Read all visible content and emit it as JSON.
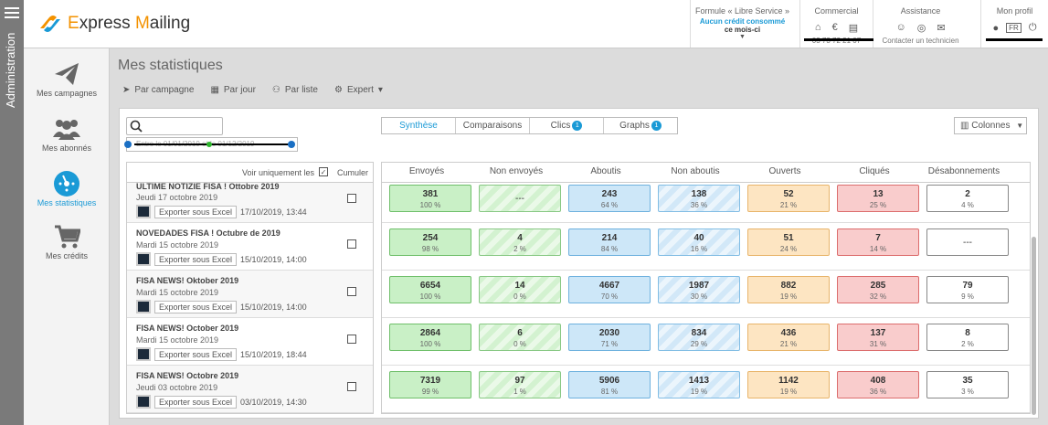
{
  "admin": {
    "label": "Administration"
  },
  "logo": {
    "part1": "E",
    "part2": "xpress ",
    "part3": "M",
    "part4": "ailing"
  },
  "header": {
    "formule": {
      "line1": "Formule « Libre Service »",
      "line2": "Aucun crédit consommé",
      "line3": "ce mois-ci"
    },
    "commercial": {
      "title": "Commercial",
      "sub": "03 73 72 21 07"
    },
    "assistance": {
      "title": "Assistance",
      "sub": "Contacter un technicien"
    },
    "profil": {
      "title": "Mon profil",
      "lang": "FR"
    }
  },
  "sidebar": [
    {
      "label": "Mes campagnes",
      "icon": "paper-plane-icon"
    },
    {
      "label": "Mes abonnés",
      "icon": "users-icon"
    },
    {
      "label": "Mes statistiques",
      "icon": "dashboard-icon"
    },
    {
      "label": "Mes crédits",
      "icon": "cart-icon"
    }
  ],
  "page": {
    "title": "Mes statistiques"
  },
  "subtabs": [
    {
      "label": "Par campagne"
    },
    {
      "label": "Par jour"
    },
    {
      "label": "Par liste"
    },
    {
      "label": "Expert"
    }
  ],
  "filter": {
    "search_placeholder": "",
    "daterange": "Entre le 01/01/2019 et le 01/12/2019"
  },
  "view_tabs": [
    {
      "label": "Synthèse",
      "badge": ""
    },
    {
      "label": "Comparaisons",
      "badge": ""
    },
    {
      "label": "Clics",
      "badge": "1"
    },
    {
      "label": "Graphs",
      "badge": "1"
    }
  ],
  "columns_btn": "Colonnes",
  "left_header": {
    "only": "Voir uniquement les",
    "cumuler": "Cumuler"
  },
  "export_label": "Exporter sous Excel",
  "columns": [
    "Envoyés",
    "Non envoyés",
    "Aboutis",
    "Non aboutis",
    "Ouverts",
    "Cliqués",
    "Désabonnements"
  ],
  "campaigns": [
    {
      "title": "ULTIME NOTIZIE FISA ! Ottobre 2019",
      "date": "Jeudi 17 octobre 2019",
      "sent_at": "17/10/2019, 13:44",
      "stats": [
        [
          "381",
          "100 %"
        ],
        [
          "---",
          ""
        ],
        [
          "243",
          "64 %"
        ],
        [
          "138",
          "36 %"
        ],
        [
          "52",
          "21 %"
        ],
        [
          "13",
          "25 %"
        ],
        [
          "2",
          "4 %"
        ]
      ]
    },
    {
      "title": "NOVEDADES FISA ! Octubre de 2019",
      "date": "Mardi 15 octobre 2019",
      "sent_at": "15/10/2019, 14:00",
      "stats": [
        [
          "254",
          "98 %"
        ],
        [
          "4",
          "2 %"
        ],
        [
          "214",
          "84 %"
        ],
        [
          "40",
          "16 %"
        ],
        [
          "51",
          "24 %"
        ],
        [
          "7",
          "14 %"
        ],
        [
          "---",
          ""
        ]
      ]
    },
    {
      "title": "FISA NEWS! Oktober 2019",
      "date": "Mardi 15 octobre 2019",
      "sent_at": "15/10/2019, 14:00",
      "stats": [
        [
          "6654",
          "100 %"
        ],
        [
          "14",
          "0 %"
        ],
        [
          "4667",
          "70 %"
        ],
        [
          "1987",
          "30 %"
        ],
        [
          "882",
          "19 %"
        ],
        [
          "285",
          "32 %"
        ],
        [
          "79",
          "9 %"
        ]
      ]
    },
    {
      "title": "FISA NEWS! October 2019",
      "date": "Mardi 15 octobre 2019",
      "sent_at": "15/10/2019, 18:44",
      "stats": [
        [
          "2864",
          "100 %"
        ],
        [
          "6",
          "0 %"
        ],
        [
          "2030",
          "71 %"
        ],
        [
          "834",
          "29 %"
        ],
        [
          "436",
          "21 %"
        ],
        [
          "137",
          "31 %"
        ],
        [
          "8",
          "2 %"
        ]
      ]
    },
    {
      "title": "FISA NEWS! Octobre 2019",
      "date": "Jeudi 03 octobre 2019",
      "sent_at": "03/10/2019, 14:30",
      "stats": [
        [
          "7319",
          "99 %"
        ],
        [
          "97",
          "1 %"
        ],
        [
          "5906",
          "81 %"
        ],
        [
          "1413",
          "19 %"
        ],
        [
          "1142",
          "19 %"
        ],
        [
          "408",
          "36 %"
        ],
        [
          "35",
          "3 %"
        ]
      ]
    }
  ]
}
